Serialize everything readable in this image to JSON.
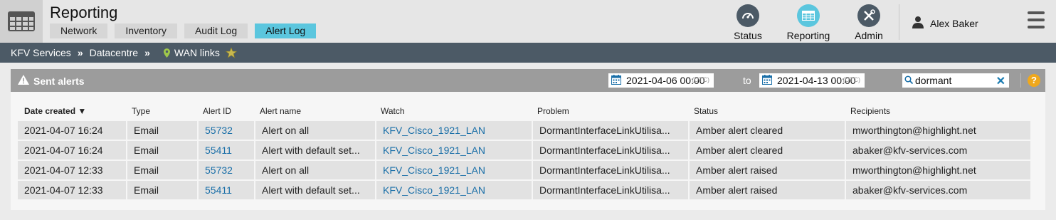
{
  "header": {
    "app_icon": "table-grid-icon",
    "title": "Reporting",
    "tabs": [
      {
        "label": "Network",
        "active": false
      },
      {
        "label": "Inventory",
        "active": false
      },
      {
        "label": "Audit Log",
        "active": false
      },
      {
        "label": "Alert Log",
        "active": true
      }
    ],
    "nav": [
      {
        "label": "Status",
        "icon": "gauge-icon"
      },
      {
        "label": "Reporting",
        "icon": "table-icon",
        "active": true
      },
      {
        "label": "Admin",
        "icon": "tools-icon"
      }
    ],
    "user": {
      "name": "Alex Baker",
      "icon": "user-icon"
    },
    "menu_icon": "hamburger-icon"
  },
  "breadcrumb": {
    "items": [
      "KFV Services",
      "Datacentre",
      "WAN links"
    ],
    "separator": "»"
  },
  "panel": {
    "title": "Sent alerts",
    "from_date": "2021-04-06 00:00",
    "to_date": "2021-04-13 00:00",
    "utc_label": "(UTC)",
    "to_label": "to",
    "search_value": "dormant",
    "help": "?"
  },
  "table": {
    "columns": [
      "Date created ▼",
      "Type",
      "Alert ID",
      "Alert name",
      "Watch",
      "Problem",
      "Status",
      "Recipients"
    ],
    "rows": [
      [
        "2021-04-07 16:24",
        "Email",
        "55732",
        "Alert on all",
        "KFV_Cisco_1921_LAN",
        "DormantInterfaceLinkUtilisa...",
        "Amber alert cleared",
        "mworthington@highlight.net"
      ],
      [
        "2021-04-07 16:24",
        "Email",
        "55411",
        "Alert with default set...",
        "KFV_Cisco_1921_LAN",
        "DormantInterfaceLinkUtilisa...",
        "Amber alert cleared",
        "abaker@kfv-services.com"
      ],
      [
        "2021-04-07 12:33",
        "Email",
        "55732",
        "Alert on all",
        "KFV_Cisco_1921_LAN",
        "DormantInterfaceLinkUtilisa...",
        "Amber alert raised",
        "mworthington@highlight.net"
      ],
      [
        "2021-04-07 12:33",
        "Email",
        "55411",
        "Alert with default set...",
        "KFV_Cisco_1921_LAN",
        "DormantInterfaceLinkUtilisa...",
        "Amber alert raised",
        "abaker@kfv-services.com"
      ]
    ]
  },
  "colors": {
    "accent": "#5bc6de",
    "breadcrumb_bg": "#4c5a66",
    "link": "#1a6fa8",
    "panel_header": "#9c9c9c",
    "help": "#f0a81c"
  }
}
